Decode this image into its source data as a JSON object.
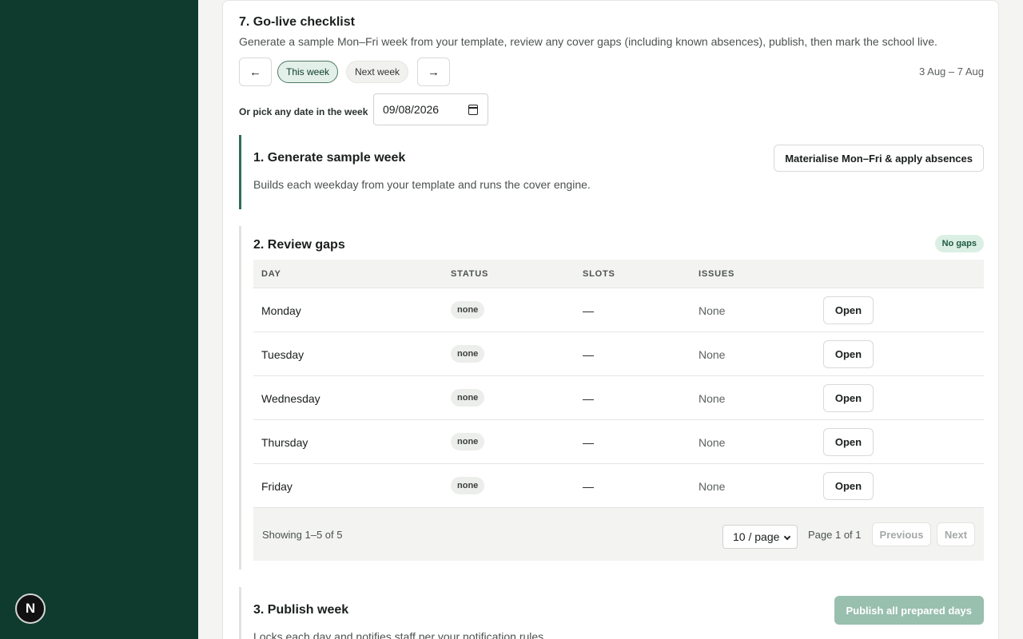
{
  "brand": {
    "badge": "N",
    "accent": "#0e3b2e"
  },
  "checklist": {
    "title": "7. Go-live checklist",
    "subtitle": "Generate a sample Mon–Fri week from your template, review any cover gaps (including known absences), publish, then mark the school live.",
    "prev_icon": "arrow-left-icon",
    "next_icon": "arrow-right-icon",
    "prev_glyph": "←",
    "next_glyph": "→",
    "this_week": "This week",
    "next_week": "Next week",
    "range": "3 Aug – 7 Aug",
    "date_label": "Or pick any date in the week",
    "date_value": "09/08/2026"
  },
  "step1": {
    "title": "1. Generate sample week",
    "desc": "Builds each weekday from your template and runs the cover engine.",
    "button": "Materialise Mon–Fri & apply absences"
  },
  "step2": {
    "title": "2. Review gaps",
    "badge": "No gaps",
    "columns": {
      "day": "DAY",
      "status": "STATUS",
      "slots": "SLOTS",
      "issues": "ISSUES"
    },
    "rows": [
      {
        "day": "Monday",
        "status": "none",
        "slots": "—",
        "issues": "None",
        "action": "Open"
      },
      {
        "day": "Tuesday",
        "status": "none",
        "slots": "—",
        "issues": "None",
        "action": "Open"
      },
      {
        "day": "Wednesday",
        "status": "none",
        "slots": "—",
        "issues": "None",
        "action": "Open"
      },
      {
        "day": "Thursday",
        "status": "none",
        "slots": "—",
        "issues": "None",
        "action": "Open"
      },
      {
        "day": "Friday",
        "status": "none",
        "slots": "—",
        "issues": "None",
        "action": "Open"
      }
    ],
    "footer": {
      "showing": "Showing 1–5 of 5",
      "per_page": "10 / page",
      "page_info": "Page 1 of 1",
      "previous": "Previous",
      "next": "Next"
    }
  },
  "step3": {
    "title": "3. Publish week",
    "desc": "Locks each day and notifies staff per your notification rules.",
    "button": "Publish all prepared days"
  }
}
